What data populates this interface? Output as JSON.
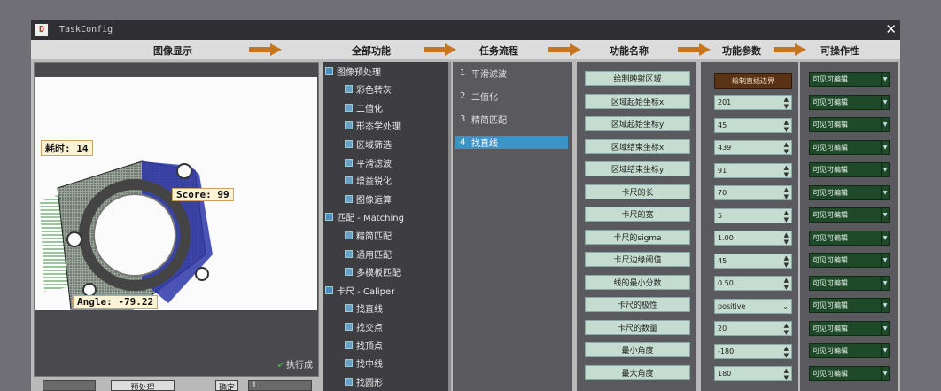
{
  "window": {
    "title": "TaskConfig",
    "icon_letter": "D"
  },
  "header": {
    "labels": [
      "图像显示",
      "全部功能",
      "任务流程",
      "功能名称",
      "功能参数",
      "可操作性"
    ]
  },
  "image_panel": {
    "time_tag": "耗时: 14",
    "score_tag": "Score: 99",
    "angle_tag": "Angle: -79.22",
    "run_status": "执行成",
    "bottom_button": "预处理",
    "bottom_small": "确定",
    "bottom_value": "1"
  },
  "tree": {
    "items": [
      {
        "label": "图像预处理",
        "type": "category"
      },
      {
        "label": "彩色转灰",
        "type": "item"
      },
      {
        "label": "二值化",
        "type": "item"
      },
      {
        "label": "形态学处理",
        "type": "item"
      },
      {
        "label": "区域筛选",
        "type": "item"
      },
      {
        "label": "平滑滤波",
        "type": "item"
      },
      {
        "label": "增益锐化",
        "type": "item"
      },
      {
        "label": "图像运算",
        "type": "item"
      },
      {
        "label": "匹配 - Matching",
        "type": "category"
      },
      {
        "label": "精简匹配",
        "type": "item"
      },
      {
        "label": "通用匹配",
        "type": "item"
      },
      {
        "label": "多模板匹配",
        "type": "item"
      },
      {
        "label": "卡尺 - Caliper",
        "type": "category"
      },
      {
        "label": "找直线",
        "type": "item"
      },
      {
        "label": "找交点",
        "type": "item"
      },
      {
        "label": "找顶点",
        "type": "item"
      },
      {
        "label": "找中线",
        "type": "item"
      },
      {
        "label": "找圆形",
        "type": "item"
      }
    ]
  },
  "flow": {
    "items": [
      {
        "num": "1",
        "label": "平滑滤波"
      },
      {
        "num": "2",
        "label": "二值化"
      },
      {
        "num": "3",
        "label": "精简匹配"
      },
      {
        "num": "4",
        "label": "找直线"
      }
    ],
    "selected_index": 3
  },
  "names": {
    "items": [
      "绘制映射区域",
      "区域起始坐标x",
      "区域起始坐标y",
      "区域结束坐标x",
      "区域结束坐标y",
      "卡尺的长",
      "卡尺的宽",
      "卡尺的sigma",
      "卡尺边缘阈值",
      "线的最小分数",
      "卡尺的极性",
      "卡尺的数量",
      "最小角度",
      "最大角度"
    ]
  },
  "params": {
    "draw_button": "绘制直线边界",
    "values": [
      "201",
      "45",
      "439",
      "91",
      "70",
      "5",
      "1.00",
      "45",
      "0.50",
      "positive",
      "20",
      "-180",
      "180"
    ],
    "dropdown_index": 9
  },
  "ops": {
    "option": "可见可编辑",
    "count": 14
  },
  "colors": {
    "arrow": "#c8761e",
    "selected_flow": "#3c93c8",
    "name_button": "#c5dcd1",
    "ops_select": "#1e4a2a",
    "draw_button": "#5a3317"
  }
}
